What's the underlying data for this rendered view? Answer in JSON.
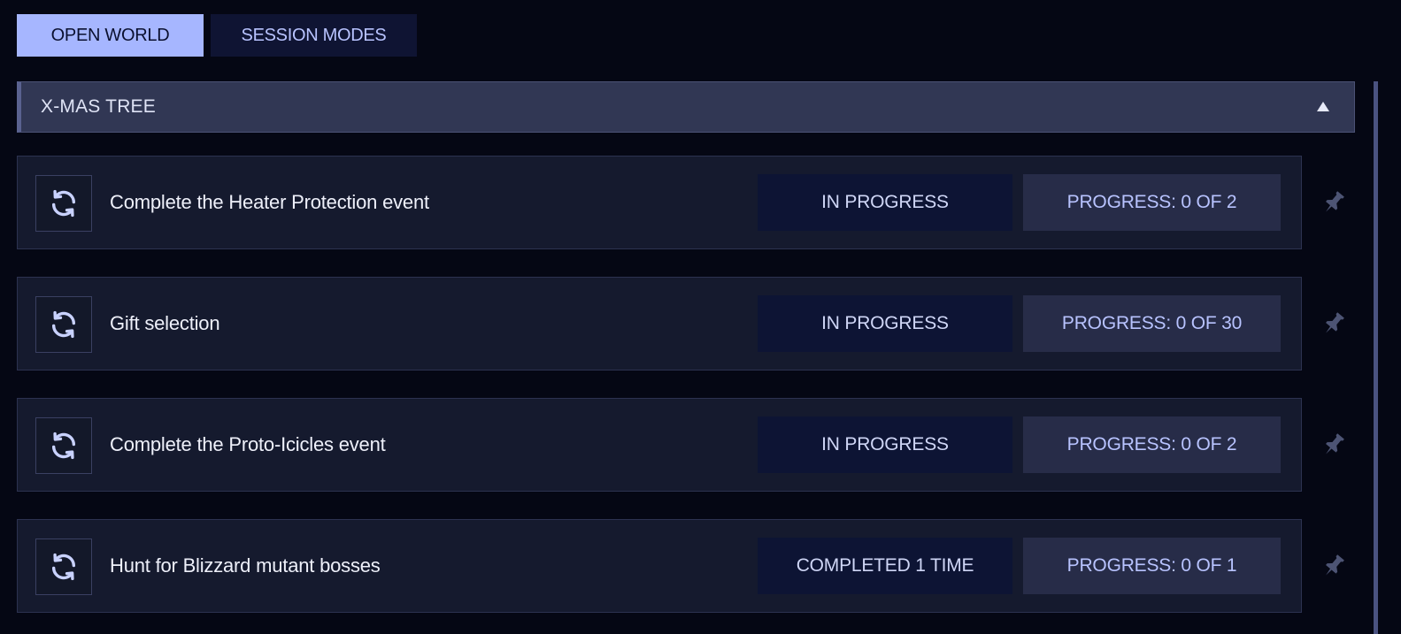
{
  "tabs": [
    {
      "label": "OPEN WORLD",
      "active": true
    },
    {
      "label": "SESSION MODES",
      "active": false
    }
  ],
  "section": {
    "title": "X-MAS TREE",
    "expanded": true
  },
  "tasks": [
    {
      "title": "Complete the Heater Protection event",
      "status": "IN PROGRESS",
      "progress": "PROGRESS: 0 OF 2",
      "icon": "repeat-icon"
    },
    {
      "title": "Gift selection",
      "status": "IN PROGRESS",
      "progress": "PROGRESS: 0 OF 30",
      "icon": "repeat-icon"
    },
    {
      "title": "Complete the Proto-Icicles event",
      "status": "IN PROGRESS",
      "progress": "PROGRESS: 0 OF 2",
      "icon": "repeat-icon"
    },
    {
      "title": "Hunt for Blizzard mutant bosses",
      "status": "COMPLETED 1 TIME",
      "progress": "PROGRESS: 0 OF 1",
      "icon": "repeat-icon"
    }
  ],
  "colors": {
    "background": "#050714",
    "accent": "#a6b6ff",
    "row": "#151a2e",
    "status_bg": "#0d1434",
    "progress_bg": "#272c48"
  }
}
